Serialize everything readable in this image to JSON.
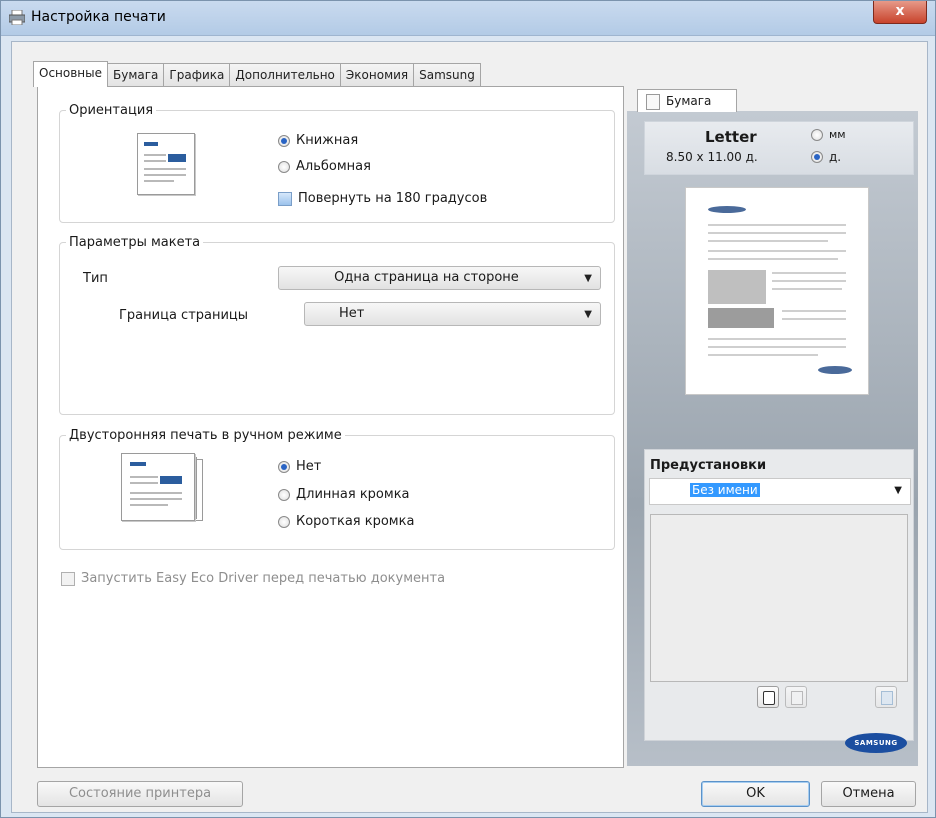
{
  "window": {
    "title": "Настройка печати",
    "close": "x"
  },
  "tabs": [
    "Основные",
    "Бумага",
    "Графика",
    "Дополнительно",
    "Экономия",
    "Samsung"
  ],
  "orientation": {
    "legend": "Ориентация",
    "portrait": "Книжная",
    "landscape": "Альбомная",
    "rotate": "Повернуть на 180 градусов"
  },
  "layout": {
    "legend": "Параметры макета",
    "type_label": "Тип",
    "type_value": "Одна страница на стороне",
    "border_label": "Граница страницы",
    "border_value": "Нет"
  },
  "duplex": {
    "legend": "Двусторонняя печать в ручном режиме",
    "none": "Нет",
    "long": "Длинная кромка",
    "short": "Короткая кромка"
  },
  "eco": {
    "label": "Запустить Easy Eco Driver перед печатью документа"
  },
  "right": {
    "tab": "Бумага",
    "paper_name": "Letter",
    "paper_size": "8.50 x 11.00 д.",
    "unit_mm": "мм",
    "unit_in": "д.",
    "presets_title": "Предустановки",
    "preset_value": "Без имени",
    "logo": "SAMSUNG"
  },
  "footer": {
    "status": "Состояние принтера",
    "ok": "OK",
    "cancel": "Отмена"
  }
}
